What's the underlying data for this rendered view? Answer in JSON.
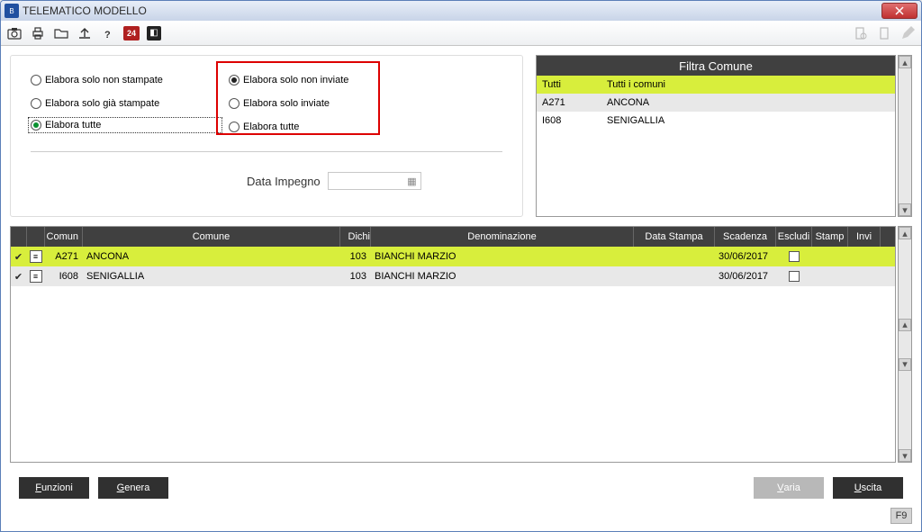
{
  "window": {
    "title": "TELEMATICO MODELLO"
  },
  "toolbar": {
    "badge": "24"
  },
  "options": {
    "left": [
      {
        "label": "Elabora solo non stampate",
        "selected": false
      },
      {
        "label": "Elabora solo già stampate",
        "selected": false
      },
      {
        "label": "Elabora tutte",
        "selected": true
      }
    ],
    "right": [
      {
        "label": "Elabora solo non inviate",
        "selected": true
      },
      {
        "label": "Elabora solo inviate",
        "selected": false
      },
      {
        "label": "Elabora tutte",
        "selected": false
      }
    ],
    "data_impegno_label": "Data Impegno",
    "data_impegno_value": ""
  },
  "filter": {
    "header": "Filtra Comune",
    "rows": [
      {
        "code": "Tutti",
        "name": "Tutti i comuni",
        "selected": true
      },
      {
        "code": "A271",
        "name": "ANCONA",
        "selected": false,
        "alt": true
      },
      {
        "code": "I608",
        "name": "SENIGALLIA",
        "selected": false
      }
    ]
  },
  "grid": {
    "headers": {
      "comune_code": "Comun",
      "comune": "Comune",
      "dich": "Dichi",
      "denom": "Denominazione",
      "data_stampa": "Data Stampa",
      "scadenza": "Scadenza",
      "escludi": "Escludi",
      "stamp": "Stamp",
      "invi": "Invi"
    },
    "rows": [
      {
        "code": "A271",
        "comune": "ANCONA",
        "dich": "103",
        "denom": "BIANCHI MARZIO",
        "stampa": "",
        "scadenza": "30/06/2017",
        "selected": true
      },
      {
        "code": "I608",
        "comune": "SENIGALLIA",
        "dich": "103",
        "denom": "BIANCHI MARZIO",
        "stampa": "",
        "scadenza": "30/06/2017",
        "selected": false,
        "alt": true
      }
    ]
  },
  "footer": {
    "funzioni": "unzioni",
    "genera": "enera",
    "varia": "aria",
    "uscita": "scita",
    "hint": "F9"
  }
}
